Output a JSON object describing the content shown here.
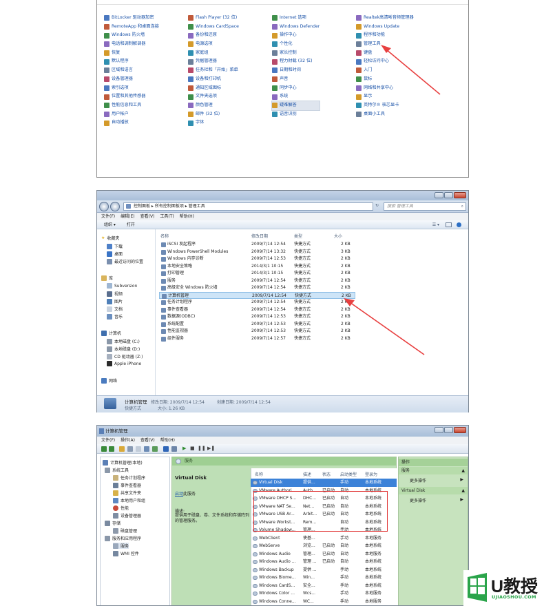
{
  "control_panel": {
    "col1": [
      "BitLocker 驱动器加密",
      "RemoteApp 和桌面连接",
      "Windows 防火墙",
      "电话和调制解调器",
      "恢复",
      "默认程序",
      "区域和语言",
      "设备管理器",
      "索引选项",
      "位置和其他传感器",
      "性能信息和工具",
      "用户帐户",
      "自动播放"
    ],
    "col2": [
      "Flash Player (32 位)",
      "Windows CardSpace",
      "备份和还原",
      "电源选项",
      "家庭组",
      "凭据管理器",
      "任务栏和「开始」菜单",
      "设备和打印机",
      "通知区域图标",
      "文件夹选项",
      "颜色管理",
      "邮件 (32 位)",
      "字体"
    ],
    "col3": [
      "Internet 选项",
      "Windows Defender",
      "操作中心",
      "个性化",
      "家长控制",
      "程力财载 (32 位)",
      "日期和时间",
      "声音",
      "同步中心",
      "系统",
      "疑难解答",
      "语音识别"
    ],
    "col4": [
      "Realtek高清晰音频管理器",
      "Windows Update",
      "程序和功能",
      "管理工具",
      "键盘",
      "轻松访问中心",
      "入门",
      "鼠标",
      "网络和共享中心",
      "显示",
      "英特尔® 核芯显卡",
      "桌面小工具"
    ]
  },
  "explorer": {
    "address": "控制面板 ▸ 所有控制面板项 ▸ 管理工具",
    "search_placeholder": "搜索 管理工具",
    "menu": [
      "文件(F)",
      "编辑(E)",
      "查看(V)",
      "工具(T)",
      "帮助(H)"
    ],
    "toolbar": [
      "组织 ▾",
      "打开"
    ],
    "nav": {
      "favorites": "收藏夹",
      "fav_items": [
        "下载",
        "桌面",
        "最近访问的位置"
      ],
      "library": "库",
      "lib_items": [
        "Subversion",
        "视频",
        "图片",
        "文档",
        "音乐"
      ],
      "computer": "计算机",
      "comp_items": [
        "本地磁盘 (C:)",
        "本地磁盘 (D:)",
        "CD 驱动器 (Z:)",
        "Apple iPhone"
      ],
      "network": "网络"
    },
    "columns": [
      "名称",
      "修改日期",
      "类型",
      "大小"
    ],
    "files": [
      {
        "name": "iSCSI 发起程序",
        "date": "2009/7/14 12:54",
        "type": "快捷方式",
        "size": "2 KB"
      },
      {
        "name": "Windows PowerShell Modules",
        "date": "2009/7/14 13:32",
        "type": "快捷方式",
        "size": "3 KB"
      },
      {
        "name": "Windows 内存诊断",
        "date": "2009/7/14 12:53",
        "type": "快捷方式",
        "size": "2 KB"
      },
      {
        "name": "本地安全策略",
        "date": "2014/3/1 10:15",
        "type": "快捷方式",
        "size": "2 KB"
      },
      {
        "name": "打印管理",
        "date": "2014/3/1 10:15",
        "type": "快捷方式",
        "size": "2 KB"
      },
      {
        "name": "服务",
        "date": "2009/7/14 12:54",
        "type": "快捷方式",
        "size": "2 KB"
      },
      {
        "name": "高级安全 Windows 防火墙",
        "date": "2009/7/14 12:54",
        "type": "快捷方式",
        "size": "2 KB"
      },
      {
        "name": "计算机管理",
        "date": "2009/7/14 12:54",
        "type": "快捷方式",
        "size": "2 KB"
      },
      {
        "name": "任务计划程序",
        "date": "2009/7/14 12:54",
        "type": "快捷方式",
        "size": "2 KB"
      },
      {
        "name": "事件查看器",
        "date": "2009/7/14 12:54",
        "type": "快捷方式",
        "size": "2 KB"
      },
      {
        "name": "数据源(ODBC)",
        "date": "2009/7/14 12:53",
        "type": "快捷方式",
        "size": "2 KB"
      },
      {
        "name": "系统配置",
        "date": "2009/7/14 12:53",
        "type": "快捷方式",
        "size": "2 KB"
      },
      {
        "name": "性能监视器",
        "date": "2009/7/14 12:53",
        "type": "快捷方式",
        "size": "2 KB"
      },
      {
        "name": "组件服务",
        "date": "2009/7/14 12:57",
        "type": "快捷方式",
        "size": "2 KB"
      }
    ],
    "status": {
      "name": "计算机管理",
      "modified_label": "修改日期: 2009/7/14 12:54",
      "created_label": "创建日期: 2009/7/14 12:54",
      "type": "快捷方式",
      "size": "大小: 1.26 KB"
    }
  },
  "comp_mgmt": {
    "title": "计算机管理",
    "menu": [
      "文件(F)",
      "操作(A)",
      "查看(V)",
      "帮助(H)"
    ],
    "tree": [
      "计算机管理(本地)",
      "系统工具",
      "任务计划程序",
      "事件查看器",
      "共享文件夹",
      "本地用户和组",
      "性能",
      "设备管理器",
      "存储",
      "磁盘管理",
      "服务和应用程序",
      "服务",
      "WMI 控件"
    ],
    "mid_header": "服务",
    "selected_title": "Virtual Disk",
    "start_link": "启动",
    "start_suffix": "此服务",
    "desc_label": "描述:",
    "desc_text": "提供用于磁盘、卷、文件系统和存储阵列的管理服务。",
    "columns": [
      "名称",
      "描述",
      "状态",
      "启动类型",
      "登录为"
    ],
    "services": [
      [
        "Virtual Disk",
        "提供...",
        "",
        "手动",
        "本地系统"
      ],
      [
        "VMware Authori...",
        "Auth...",
        "已启动",
        "自动",
        "本地系统"
      ],
      [
        "VMware DHCP S...",
        "DHC...",
        "已启动",
        "自动",
        "本地系统"
      ],
      [
        "VMware NAT Se...",
        "Net...",
        "已启动",
        "自动",
        "本地系统"
      ],
      [
        "VMware USB Ar...",
        "Arbit...",
        "已启动",
        "自动",
        "本地系统"
      ],
      [
        "VMware Workst...",
        "Rem...",
        "",
        "自动",
        "本地系统"
      ],
      [
        "Volume Shadow...",
        "管理...",
        "",
        "手动",
        "本地系统"
      ],
      [
        "WebClient",
        "使基...",
        "",
        "手动",
        "本地服务"
      ],
      [
        "WebServe",
        "浏览...",
        "已启动",
        "自动",
        "本地系统"
      ],
      [
        "Windows Audio",
        "管理...",
        "已启动",
        "自动",
        "本地服务"
      ],
      [
        "Windows Audio ...",
        "管理 ...",
        "已启动",
        "自动",
        "本地系统"
      ],
      [
        "Windows Backup",
        "提供 ...",
        "",
        "手动",
        "本地系统"
      ],
      [
        "Windows Biome...",
        "Win...",
        "",
        "手动",
        "本地系统"
      ],
      [
        "Windows CardS...",
        "安全...",
        "",
        "手动",
        "本地系统"
      ],
      [
        "Windows Color ...",
        "Wcs...",
        "",
        "手动",
        "本地服务"
      ],
      [
        "Windows Conne...",
        "WC...",
        "",
        "手动",
        "本地服务"
      ]
    ],
    "actions_header": "操作",
    "actions": [
      {
        "section": "服务",
        "item": "更多操作"
      },
      {
        "section": "Virtual Disk",
        "item": "更多操作"
      }
    ]
  },
  "logo": {
    "brand": "U教授",
    "url": "UJIAOSHOU.COM"
  },
  "colors": {
    "arrow": "#e84040",
    "highlight_box": "#e03030",
    "link": "#1a52a8"
  }
}
